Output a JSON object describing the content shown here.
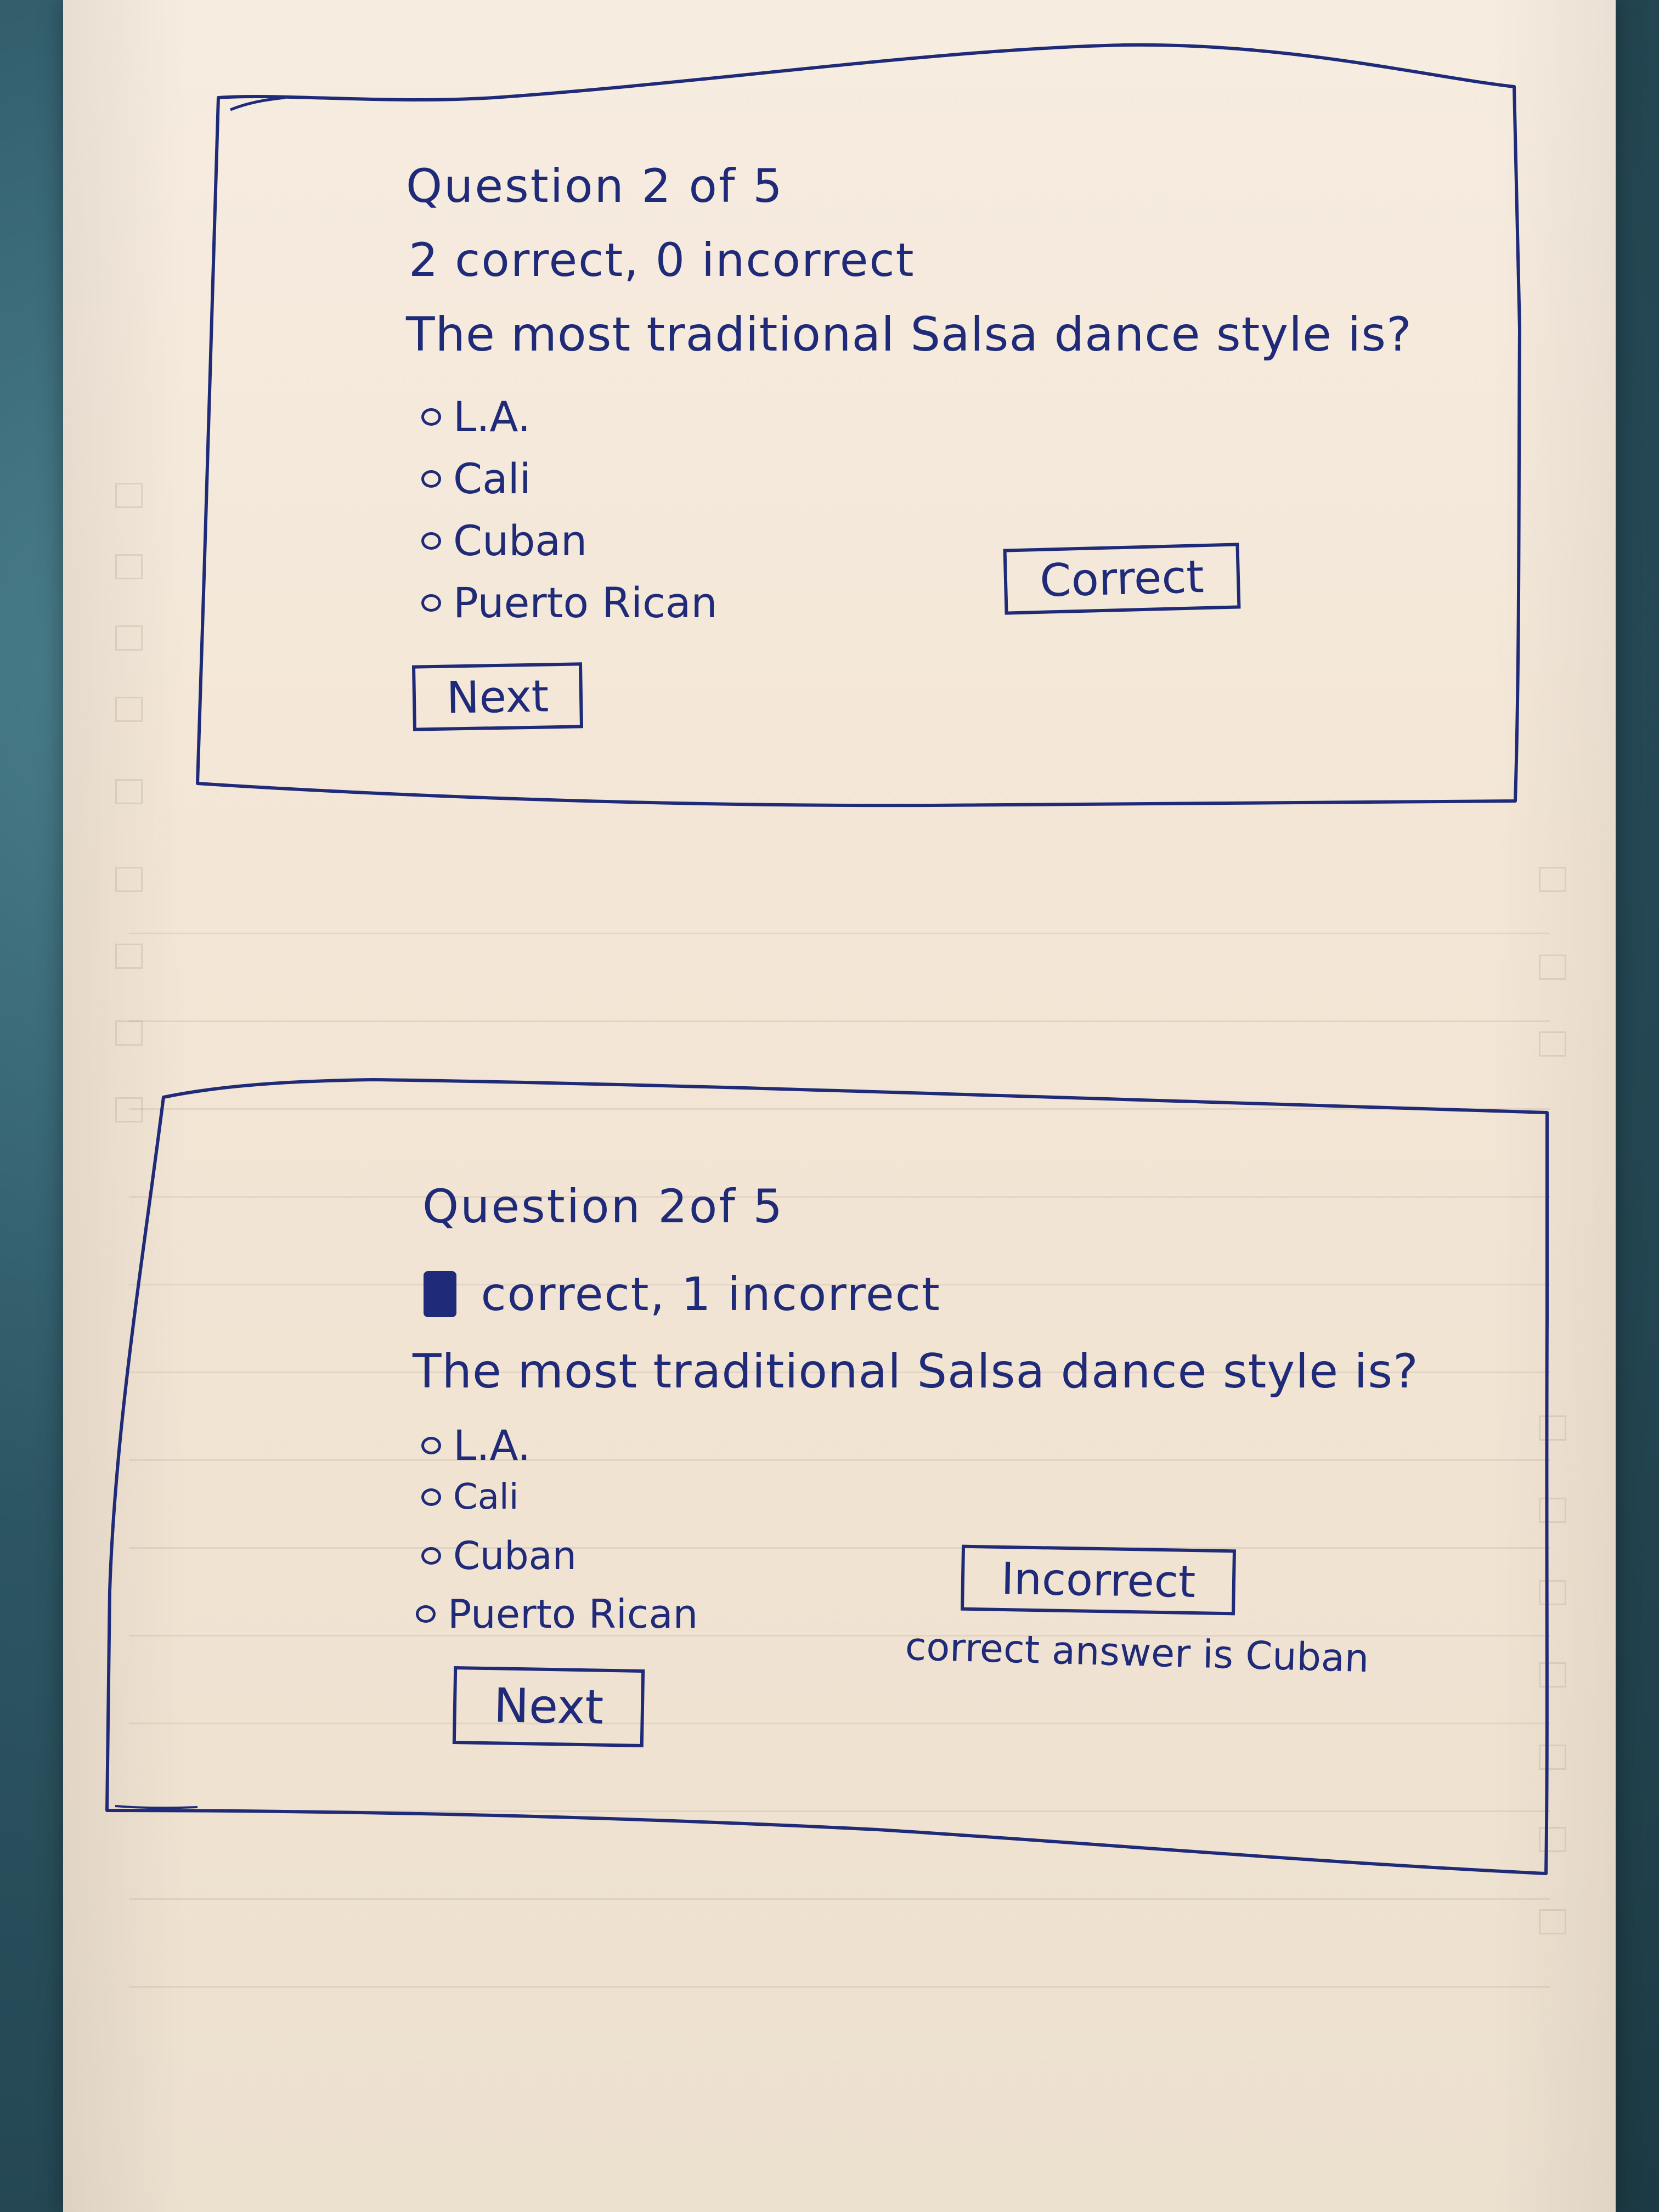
{
  "screens": [
    {
      "question_counter": "Question 2 of 5",
      "score": "2 correct, 0 incorrect",
      "question": "The most traditional Salsa dance style is?",
      "options": [
        "L.A.",
        "Cali",
        "Cuban",
        "Puerto Rican"
      ],
      "feedback_label": "Correct",
      "next_label": "Next"
    },
    {
      "question_counter": "Question 2of 5",
      "score_count": "1",
      "score_rest": "correct, 1 incorrect",
      "question": "The most traditional Salsa dance style is?",
      "options": [
        "L.A.",
        "Cali",
        "Cuban",
        "Puerto Rican"
      ],
      "feedback_label": "Incorrect",
      "feedback_note": "correct answer is Cuban",
      "next_label": "Next"
    }
  ],
  "colors": {
    "ink": "#1f2a78",
    "paper": "#f3e6d6"
  }
}
